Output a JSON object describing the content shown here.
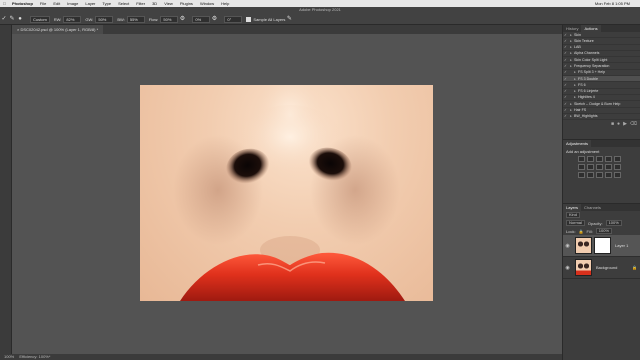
{
  "menubar": {
    "app_name": "Photoshop",
    "items": [
      "File",
      "Edit",
      "Image",
      "Layer",
      "Type",
      "Select",
      "Filter",
      "3D",
      "View",
      "Plugins",
      "Window",
      "Help"
    ],
    "clock": "Mon Feb 8 1:05 PM"
  },
  "window_title": "Adobe Photoshop 2021",
  "options": {
    "preset": "Custom",
    "rw_label": "RW:",
    "rw_value": "82%",
    "gw_label": "GW:",
    "gw_value": "50%",
    "bw_label": "BW:",
    "bw_value": "55%",
    "flow_label": "Flow:",
    "flow_value": "50%",
    "smoothing_value": "0%",
    "angle_value": "0°",
    "sample_all_layers": "Sample All Layers"
  },
  "document_tab": "DSC02042.psd @ 100% (Layer 1, RGB/8) *",
  "status": {
    "zoom": "100%",
    "efficiency": "Efficiency: 100%*"
  },
  "actions_panel": {
    "tabs": [
      "History",
      "Actions"
    ],
    "active_tab": "Actions",
    "items": [
      {
        "label": "Skin",
        "level": 0,
        "type": "folder"
      },
      {
        "label": "Skin Texture",
        "level": 0,
        "type": "folder"
      },
      {
        "label": "LAB",
        "level": 0,
        "type": "folder"
      },
      {
        "label": "Alpha Channels",
        "level": 0,
        "type": "folder"
      },
      {
        "label": "Skin Color Split Light",
        "level": 0,
        "type": "folder"
      },
      {
        "label": "Frequency Separation",
        "level": 0,
        "type": "folder"
      },
      {
        "label": "FS Split 3 + Help",
        "level": 1,
        "type": "action"
      },
      {
        "label": "FS 3 Double",
        "level": 1,
        "type": "action"
      },
      {
        "label": "FS 6",
        "level": 1,
        "type": "action"
      },
      {
        "label": "FS 6 Linjerte",
        "level": 1,
        "type": "action"
      },
      {
        "label": "Highlites 4",
        "level": 1,
        "type": "action"
      },
      {
        "label": "Sketch -- Dodge & Burn Help",
        "level": 0,
        "type": "folder"
      },
      {
        "label": "Hair FS",
        "level": 0,
        "type": "folder"
      },
      {
        "label": "BW_Highlights",
        "level": 0,
        "type": "folder"
      }
    ]
  },
  "adjustments": {
    "tab": "Adjustments",
    "label": "Add an adjustment"
  },
  "layers_panel": {
    "tabs": [
      "Layers",
      "Channels"
    ],
    "filter": "Kind",
    "blend_mode": "Normal",
    "opacity_label": "Opacity:",
    "opacity_value": "100%",
    "lock_label": "Lock:",
    "fill_label": "Fill:",
    "fill_value": "100%",
    "layers": [
      {
        "name": "Layer 1"
      },
      {
        "name": "Background"
      }
    ]
  },
  "colors": {
    "ui_bg": "#535353",
    "panel_bg": "#3d3d3d",
    "skin": "#f2cdb0",
    "lip_red": "#d8301c"
  },
  "icons": [
    "brush-tool-icon",
    "eye-icon",
    "folder-icon",
    "checkmark-icon"
  ]
}
